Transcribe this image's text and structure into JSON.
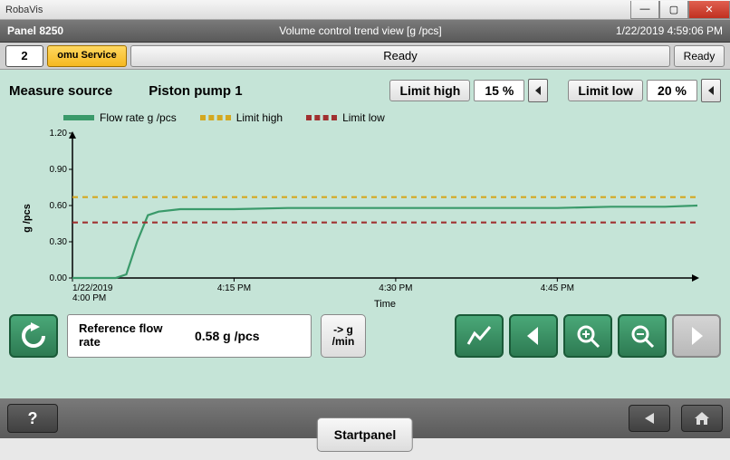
{
  "window": {
    "title": "RobaVis"
  },
  "header": {
    "panel": "Panel 8250",
    "title": "Volume control trend view [g /pcs]",
    "datetime": "1/22/2019 4:59:06 PM"
  },
  "status": {
    "num": "2",
    "service": "omu Service",
    "ready_main": "Ready",
    "ready_small": "Ready"
  },
  "top": {
    "measure_label": "Measure source",
    "source_value": "Piston pump 1",
    "limit_high_label": "Limit high",
    "limit_high_value": "15  %",
    "limit_low_label": "Limit low",
    "limit_low_value": "20  %"
  },
  "legend": {
    "flow": "Flow rate g /pcs",
    "high": "Limit high",
    "low": "Limit low"
  },
  "chart": {
    "ylabel": "g /pcs",
    "xlabel": "Time",
    "yticks": [
      "0.00",
      "0.30",
      "0.60",
      "0.90",
      "1.20"
    ],
    "xticks": [
      "1/22/2019 4:00 PM",
      "4:15 PM",
      "4:30 PM",
      "4:45 PM"
    ]
  },
  "ref": {
    "label": "Reference flow rate",
    "value": "0.58  g /pcs",
    "unit_btn": "-> g /min"
  },
  "footer": {
    "start": "Startpanel",
    "help": "?"
  },
  "chart_data": {
    "type": "line",
    "title": "Volume control trend view [g /pcs]",
    "xlabel": "Time",
    "ylabel": "g /pcs",
    "ylim": [
      0,
      1.2
    ],
    "x_minutes": [
      0,
      2,
      4,
      5,
      6,
      7,
      8,
      10,
      15,
      20,
      25,
      30,
      35,
      40,
      45,
      50,
      55,
      58
    ],
    "series": [
      {
        "name": "Flow rate g /pcs",
        "color": "#3a9a6a",
        "values": [
          0.0,
          0.0,
          0.0,
          0.03,
          0.3,
          0.52,
          0.55,
          0.57,
          0.57,
          0.58,
          0.58,
          0.58,
          0.58,
          0.58,
          0.58,
          0.59,
          0.59,
          0.6
        ]
      },
      {
        "name": "Limit high",
        "color": "#d4a820",
        "values": [
          0.67,
          0.67,
          0.67,
          0.67,
          0.67,
          0.67,
          0.67,
          0.67,
          0.67,
          0.67,
          0.67,
          0.67,
          0.67,
          0.67,
          0.67,
          0.67,
          0.67,
          0.67
        ]
      },
      {
        "name": "Limit low",
        "color": "#a03030",
        "values": [
          0.46,
          0.46,
          0.46,
          0.46,
          0.46,
          0.46,
          0.46,
          0.46,
          0.46,
          0.46,
          0.46,
          0.46,
          0.46,
          0.46,
          0.46,
          0.46,
          0.46,
          0.46
        ]
      }
    ],
    "x_tick_labels": [
      "1/22/2019 4:00 PM",
      "4:15 PM",
      "4:30 PM",
      "4:45 PM"
    ],
    "y_tick_labels": [
      "0.00",
      "0.30",
      "0.60",
      "0.90",
      "1.20"
    ]
  }
}
